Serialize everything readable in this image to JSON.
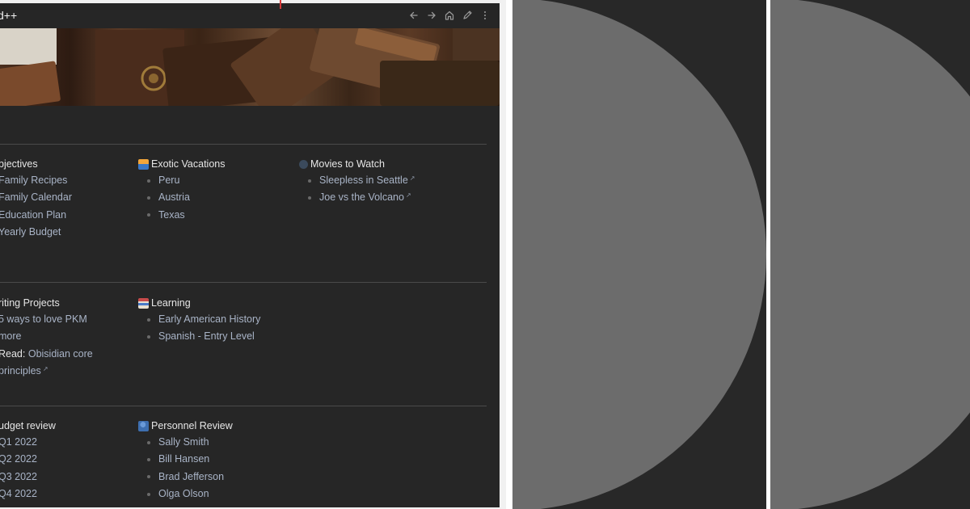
{
  "note": {
    "title": "d++"
  },
  "dashboard": {
    "row1": {
      "objectives": {
        "title": "bjectives",
        "items": [
          "Family Recipes",
          "Family Calendar",
          "Education Plan",
          "Yearly Budget"
        ]
      },
      "vacations": {
        "title": "Exotic Vacations",
        "icon": "sunset-emoji-icon",
        "items": [
          "Peru",
          "Austria",
          "Texas"
        ]
      },
      "movies": {
        "title": "Movies to Watch",
        "icon": "movie-camera-emoji-icon",
        "items": [
          "Sleepless in Seattle",
          "Joe vs the Volcano"
        ]
      }
    },
    "row2": {
      "writing": {
        "title": "riting Projects",
        "items": [
          "5 ways to love PKM",
          "more"
        ],
        "read_label": "Read:",
        "read_link_1": "Obisidian core",
        "read_link_2": "principles"
      },
      "learning": {
        "title": "Learning",
        "icon": "books-emoji-icon",
        "items": [
          "Early American History",
          "Spanish - Entry Level"
        ]
      }
    },
    "row3": {
      "budget": {
        "title": "udget review",
        "items": [
          "Q1 2022",
          "Q2 2022",
          "Q3 2022",
          "Q4 2022"
        ]
      },
      "personnel": {
        "title": "Personnel Review",
        "icon": "people-emoji-icon",
        "items": [
          "Sally Smith",
          "Bill Hansen",
          "Brad Jefferson",
          "Olga Olson"
        ]
      }
    }
  },
  "colors": {
    "window_bg": "#262626",
    "link": "#a9b4c7",
    "pane_bg": "#282828",
    "disc": "#6c6c6c"
  },
  "icons": [
    "arrow-left-icon",
    "arrow-right-icon",
    "home-icon",
    "pencil-icon",
    "more-vertical-icon",
    "external-link-icon"
  ]
}
